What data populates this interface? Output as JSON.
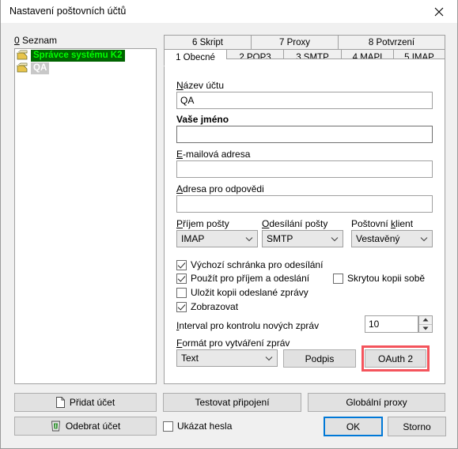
{
  "window": {
    "title": "Nastavení poštovních účtů",
    "close_icon": "close-icon"
  },
  "sidebar": {
    "label_accel": "0",
    "label_rest": " Seznam",
    "items": [
      {
        "label": "Správce systému K2",
        "icon": "folder-icon",
        "state": "selected"
      },
      {
        "label": "QA",
        "icon": "folder-icon",
        "state": "secondary"
      }
    ]
  },
  "tabs": {
    "row1": [
      {
        "label": "6 Skript",
        "active": false
      },
      {
        "label": "7 Proxy",
        "active": false
      },
      {
        "label": "8 Potvrzení",
        "active": false
      }
    ],
    "row2": [
      {
        "label": "1 Obecné",
        "active": true
      },
      {
        "label": "2 POP3",
        "active": false
      },
      {
        "label": "3 SMTP",
        "active": false
      },
      {
        "label": "4 MAPI",
        "active": false
      },
      {
        "label": "5 IMAP",
        "active": false
      }
    ]
  },
  "form": {
    "account_name": {
      "accel": "N",
      "rest": "ázev účtu",
      "value": "QA"
    },
    "your_name": {
      "label": "Vaše jméno",
      "value": ""
    },
    "email": {
      "accel": "E",
      "rest": "-mailová adresa",
      "value": ""
    },
    "reply_to": {
      "accel": "A",
      "rest": "dresa pro odpovědi",
      "value": ""
    },
    "incoming": {
      "accel": "P",
      "rest": "říjem pošty",
      "value": "IMAP"
    },
    "outgoing": {
      "accel": "O",
      "rest": "desílání pošty",
      "value": "SMTP"
    },
    "mail_client": {
      "pre": "Poštovní ",
      "accel": "k",
      "rest": "lient",
      "value": "Vestavěný"
    },
    "checkboxes": [
      {
        "label": "Výchozí schránka pro odesílání",
        "checked": true
      },
      {
        "label": "Použít pro příjem a odeslání",
        "checked": true
      },
      {
        "label": "Uložit kopii odeslané zprávy",
        "checked": false
      },
      {
        "label": "Zobrazovat",
        "checked": true
      }
    ],
    "bcc_self": {
      "label": "Skrytou kopii sobě",
      "checked": false
    },
    "interval": {
      "accel": "I",
      "rest": "nterval pro kontrolu nových zpráv",
      "value": "10"
    },
    "format": {
      "accel": "F",
      "rest": "ormát pro vytváření zpráv",
      "value": "Text"
    },
    "signature_button": "Podpis",
    "oauth_button": "OAuth 2"
  },
  "footer": {
    "add_account": {
      "label": "Přidat účet",
      "icon": "document-icon"
    },
    "remove_account": {
      "label": "Odebrat účet",
      "icon": "trash-icon"
    },
    "test_connection": "Testovat připojení",
    "global_proxy": "Globální proxy",
    "show_passwords": {
      "label": "Ukázat hesla",
      "checked": false
    },
    "ok": "OK",
    "cancel": "Storno"
  },
  "colors": {
    "selection_bg": "#006400",
    "selection_fg": "#00ff00",
    "highlight_red": "#f4545c",
    "focus_blue": "#0078d7"
  }
}
